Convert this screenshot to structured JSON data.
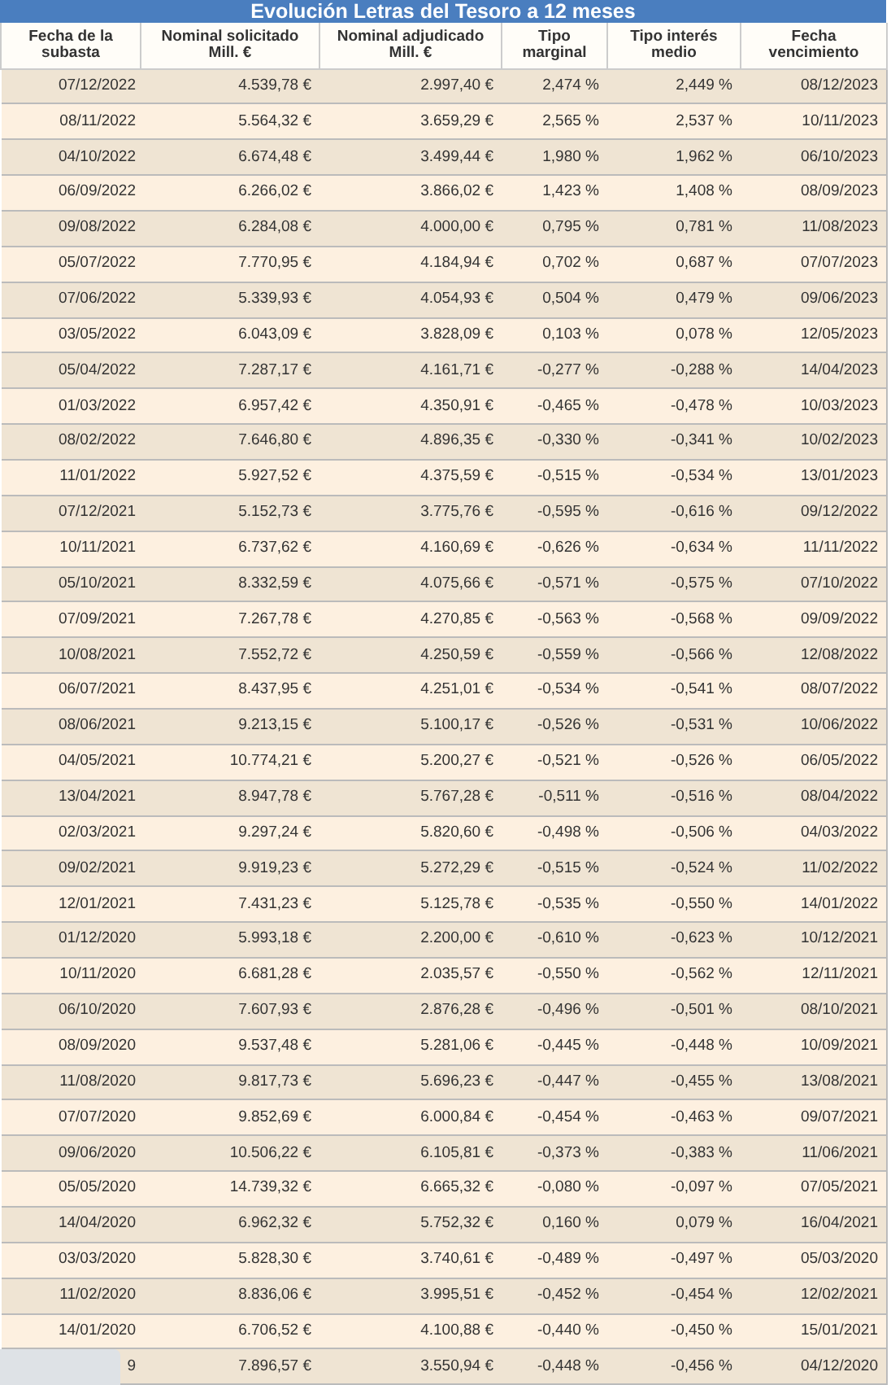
{
  "title": "Evolución Letras del Tesoro a 12 meses",
  "columns": [
    "Fecha de la subasta",
    "Nominal solicitado Mill. €",
    "Nominal adjudicado Mill. €",
    "Tipo marginal",
    "Tipo interés medio",
    "Fecha vencimiento"
  ],
  "rows": [
    [
      "07/12/2022",
      "4.539,78 €",
      "2.997,40 €",
      "2,474 %",
      "2,449 %",
      "08/12/2023"
    ],
    [
      "08/11/2022",
      "5.564,32 €",
      "3.659,29 €",
      "2,565 %",
      "2,537 %",
      "10/11/2023"
    ],
    [
      "04/10/2022",
      "6.674,48 €",
      "3.499,44 €",
      "1,980 %",
      "1,962 %",
      "06/10/2023"
    ],
    [
      "06/09/2022",
      "6.266,02 €",
      "3.866,02 €",
      "1,423 %",
      "1,408 %",
      "08/09/2023"
    ],
    [
      "09/08/2022",
      "6.284,08 €",
      "4.000,00 €",
      "0,795 %",
      "0,781 %",
      "11/08/2023"
    ],
    [
      "05/07/2022",
      "7.770,95 €",
      "4.184,94 €",
      "0,702 %",
      "0,687 %",
      "07/07/2023"
    ],
    [
      "07/06/2022",
      "5.339,93 €",
      "4.054,93 €",
      "0,504 %",
      "0,479 %",
      "09/06/2023"
    ],
    [
      "03/05/2022",
      "6.043,09 €",
      "3.828,09 €",
      "0,103 %",
      "0,078 %",
      "12/05/2023"
    ],
    [
      "05/04/2022",
      "7.287,17 €",
      "4.161,71 €",
      "-0,277 %",
      "-0,288 %",
      "14/04/2023"
    ],
    [
      "01/03/2022",
      "6.957,42 €",
      "4.350,91 €",
      "-0,465 %",
      "-0,478 %",
      "10/03/2023"
    ],
    [
      "08/02/2022",
      "7.646,80 €",
      "4.896,35 €",
      "-0,330 %",
      "-0,341 %",
      "10/02/2023"
    ],
    [
      "11/01/2022",
      "5.927,52 €",
      "4.375,59 €",
      "-0,515 %",
      "-0,534 %",
      "13/01/2023"
    ],
    [
      "07/12/2021",
      "5.152,73 €",
      "3.775,76 €",
      "-0,595 %",
      "-0,616 %",
      "09/12/2022"
    ],
    [
      "10/11/2021",
      "6.737,62 €",
      "4.160,69 €",
      "-0,626 %",
      "-0,634 %",
      "11/11/2022"
    ],
    [
      "05/10/2021",
      "8.332,59 €",
      "4.075,66 €",
      "-0,571 %",
      "-0,575 %",
      "07/10/2022"
    ],
    [
      "07/09/2021",
      "7.267,78 €",
      "4.270,85 €",
      "-0,563 %",
      "-0,568 %",
      "09/09/2022"
    ],
    [
      "10/08/2021",
      "7.552,72 €",
      "4.250,59 €",
      "-0,559 %",
      "-0,566 %",
      "12/08/2022"
    ],
    [
      "06/07/2021",
      "8.437,95 €",
      "4.251,01 €",
      "-0,534 %",
      "-0,541 %",
      "08/07/2022"
    ],
    [
      "08/06/2021",
      "9.213,15 €",
      "5.100,17 €",
      "-0,526 %",
      "-0,531 %",
      "10/06/2022"
    ],
    [
      "04/05/2021",
      "10.774,21 €",
      "5.200,27 €",
      "-0,521 %",
      "-0,526 %",
      "06/05/2022"
    ],
    [
      "13/04/2021",
      "8.947,78 €",
      "5.767,28 €",
      "-0,511 %",
      "-0,516 %",
      "08/04/2022"
    ],
    [
      "02/03/2021",
      "9.297,24 €",
      "5.820,60 €",
      "-0,498 %",
      "-0,506 %",
      "04/03/2022"
    ],
    [
      "09/02/2021",
      "9.919,23 €",
      "5.272,29 €",
      "-0,515 %",
      "-0,524 %",
      "11/02/2022"
    ],
    [
      "12/01/2021",
      "7.431,23 €",
      "5.125,78 €",
      "-0,535 %",
      "-0,550 %",
      "14/01/2022"
    ],
    [
      "01/12/2020",
      "5.993,18 €",
      "2.200,00 €",
      "-0,610 %",
      "-0,623 %",
      "10/12/2021"
    ],
    [
      "10/11/2020",
      "6.681,28 €",
      "2.035,57 €",
      "-0,550 %",
      "-0,562 %",
      "12/11/2021"
    ],
    [
      "06/10/2020",
      "7.607,93 €",
      "2.876,28 €",
      "-0,496 %",
      "-0,501 %",
      "08/10/2021"
    ],
    [
      "08/09/2020",
      "9.537,48 €",
      "5.281,06 €",
      "-0,445 %",
      "-0,448 %",
      "10/09/2021"
    ],
    [
      "11/08/2020",
      "9.817,73 €",
      "5.696,23 €",
      "-0,447 %",
      "-0,455 %",
      "13/08/2021"
    ],
    [
      "07/07/2020",
      "9.852,69 €",
      "6.000,84 €",
      "-0,454 %",
      "-0,463 %",
      "09/07/2021"
    ],
    [
      "09/06/2020",
      "10.506,22 €",
      "6.105,81 €",
      "-0,373 %",
      "-0,383 %",
      "11/06/2021"
    ],
    [
      "05/05/2020",
      "14.739,32 €",
      "6.665,32 €",
      "-0,080 %",
      "-0,097 %",
      "07/05/2021"
    ],
    [
      "14/04/2020",
      "6.962,32 €",
      "5.752,32 €",
      "0,160 %",
      "0,079 %",
      "16/04/2021"
    ],
    [
      "03/03/2020",
      "5.828,30 €",
      "3.740,61 €",
      "-0,489 %",
      "-0,497 %",
      "05/03/2020"
    ],
    [
      "11/02/2020",
      "8.836,06 €",
      "3.995,51 €",
      "-0,452 %",
      "-0,454 %",
      "12/02/2021"
    ],
    [
      "14/01/2020",
      "6.706,52 €",
      "4.100,88 €",
      "-0,440 %",
      "-0,450 %",
      "15/01/2021"
    ],
    [
      "9",
      "7.896,57 €",
      "3.550,94 €",
      "-0,448 %",
      "-0,456 %",
      "04/12/2020"
    ]
  ]
}
